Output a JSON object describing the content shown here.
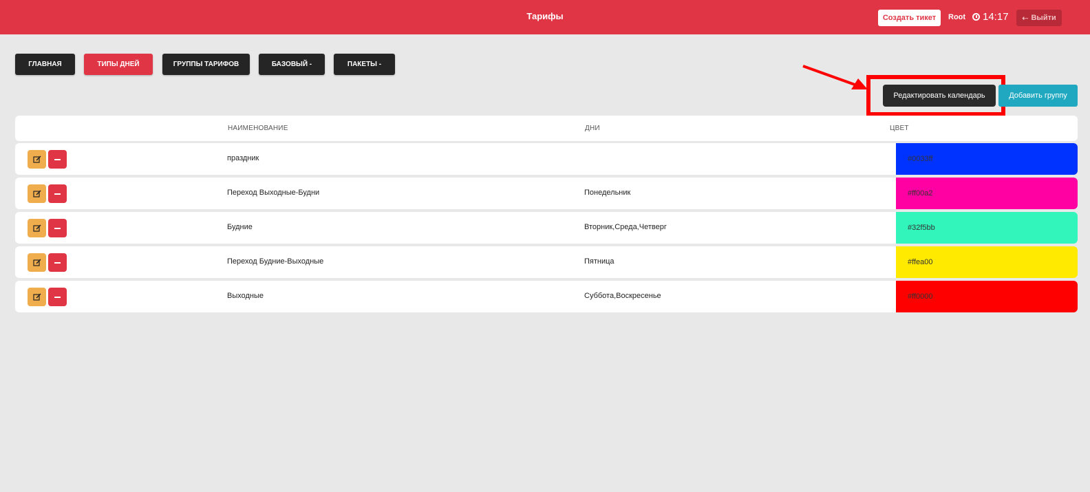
{
  "header": {
    "title": "Тарифы",
    "create_ticket": "Создать тикет",
    "user": "Root",
    "time": "14:17",
    "logout": "Выйти"
  },
  "nav": {
    "main": "ГЛАВНАЯ",
    "day_types": "ТИПЫ ДНЕЙ",
    "tariff_groups": "ГРУППЫ ТАРИФОВ",
    "basic": "БАЗОВЫЙ -",
    "packages": "ПАКЕТЫ -"
  },
  "actions": {
    "edit_calendar": "Редактировать календарь",
    "add_group": "Добавить группу"
  },
  "table": {
    "columns": [
      "НАИМЕНОВАНИЕ",
      "ДНИ",
      "ЦВЕТ"
    ],
    "rows": [
      {
        "name": "праздник",
        "days": "",
        "color": "#0033ff"
      },
      {
        "name": "Переход Выходные-Будни",
        "days": "Понедельник",
        "color": "#ff00a2"
      },
      {
        "name": "Будние",
        "days": "Вторник,Среда,Четверг",
        "color": "#32f5bb"
      },
      {
        "name": "Переход Будние-Выходные",
        "days": "Пятница",
        "color": "#ffea00"
      },
      {
        "name": "Выходные",
        "days": "Суббота,Воскресенье",
        "color": "#ff0000"
      }
    ]
  },
  "colors": {
    "header_red": "#df3545",
    "accent_teal": "#1fa8c0",
    "edit_orange": "#f0ad4e",
    "highlight": "#ff0000"
  }
}
